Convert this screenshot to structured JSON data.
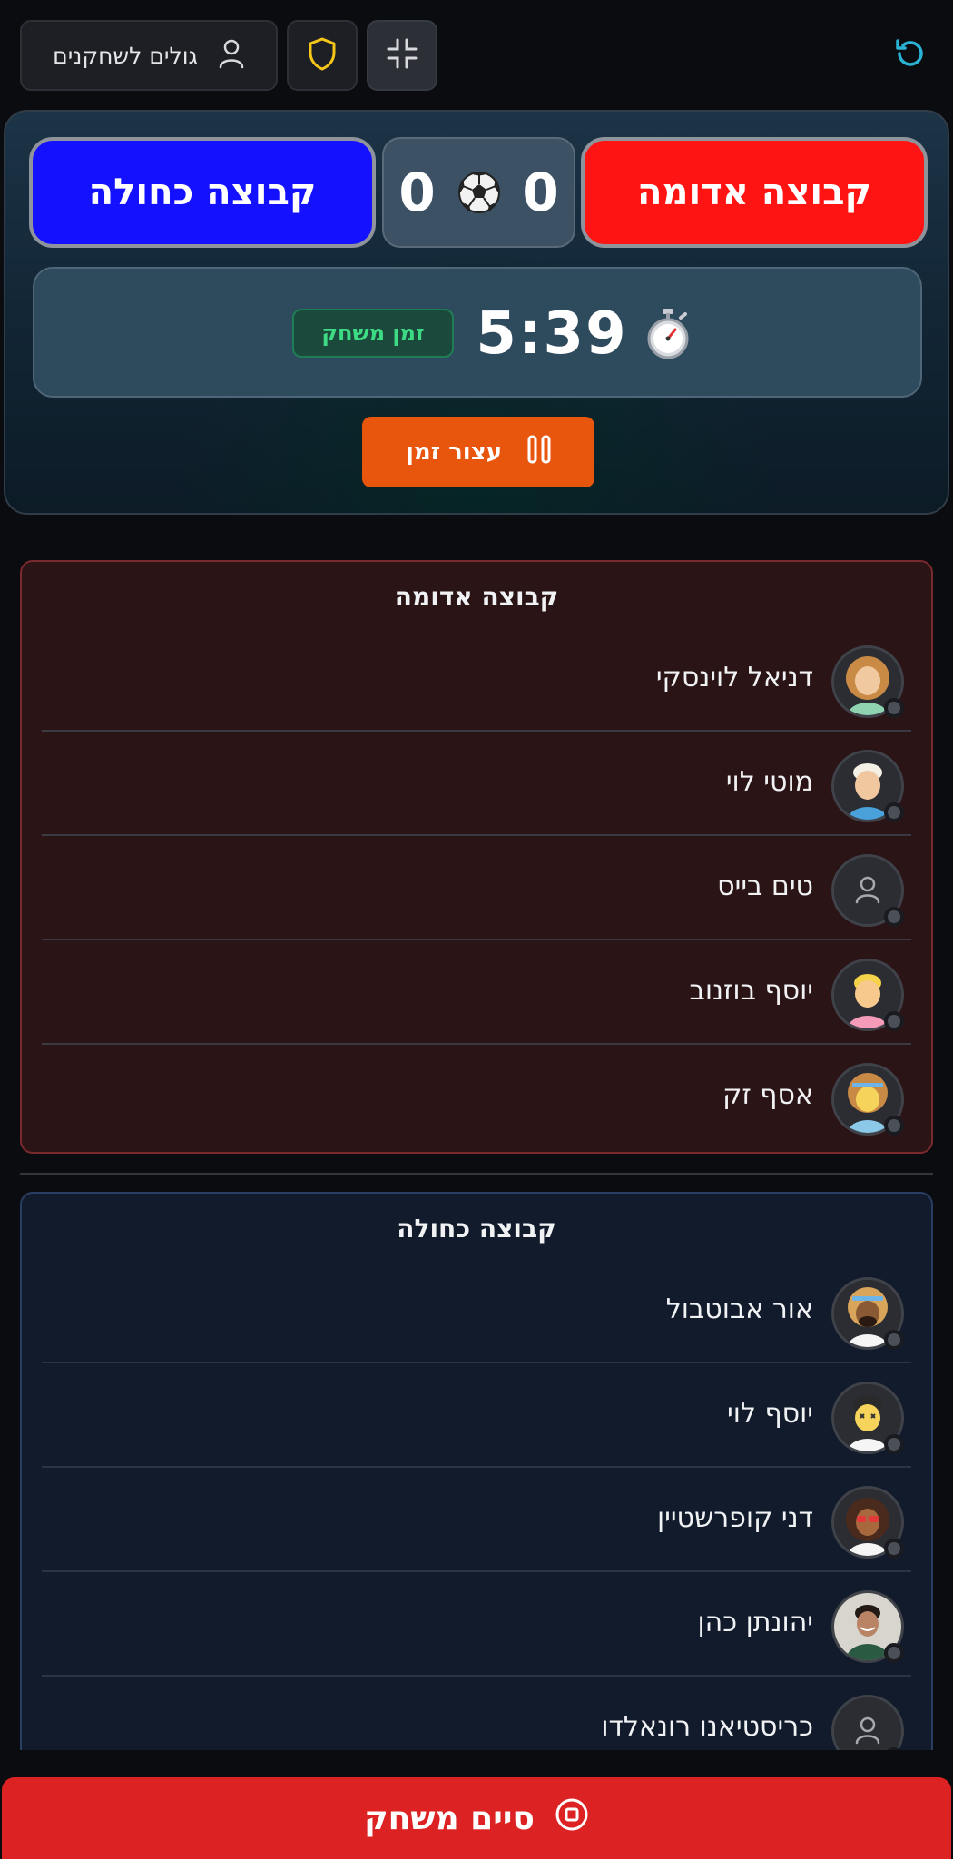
{
  "topbar": {
    "players_button_label": "גולים לשחקנים",
    "icons": [
      "user-icon",
      "shield-icon",
      "minimize-icon",
      "refresh-icon"
    ],
    "accent_shield": "#f5c518",
    "accent_refresh": "#2ab3d4"
  },
  "scoreboard": {
    "blue_team_label": "קבוצה כחולה",
    "red_team_label": "קבוצה אדומה",
    "blue_score": "0",
    "red_score": "0",
    "game_time_label": "זמן משחק",
    "timer": "5:39",
    "pause_label": "עצור זמן",
    "colors": {
      "blue": "#1411ff",
      "red": "#ff1414",
      "pause": "#e8560e",
      "badge": "#3ddc84"
    }
  },
  "red_team": {
    "title": "קבוצה אדומה",
    "players": [
      {
        "name": "דניאל לוינסקי",
        "avatar": "avatar-woman-curly"
      },
      {
        "name": "מוטי לוי",
        "avatar": "avatar-elderly-man"
      },
      {
        "name": "טים בייס",
        "avatar": "default-user-icon"
      },
      {
        "name": "יוסף בוזנוב",
        "avatar": "avatar-blonde-smiling"
      },
      {
        "name": "אסף זק",
        "avatar": "avatar-headband"
      }
    ]
  },
  "blue_team": {
    "title": "קבוצה כחולה",
    "players": [
      {
        "name": "אור אבוטבול",
        "avatar": "avatar-bearded-man"
      },
      {
        "name": "יוסף לוי",
        "avatar": "avatar-dizzy"
      },
      {
        "name": "דני קופרשטיין",
        "avatar": "avatar-woman-sunglasses"
      },
      {
        "name": "יהונתן כהן",
        "avatar": "photo-young-man"
      },
      {
        "name": "כריסטיאנו רונאלדו",
        "avatar": "default-user-icon"
      }
    ]
  },
  "footer": {
    "end_game_label": "סיים משחק",
    "color": "#dc2222"
  }
}
